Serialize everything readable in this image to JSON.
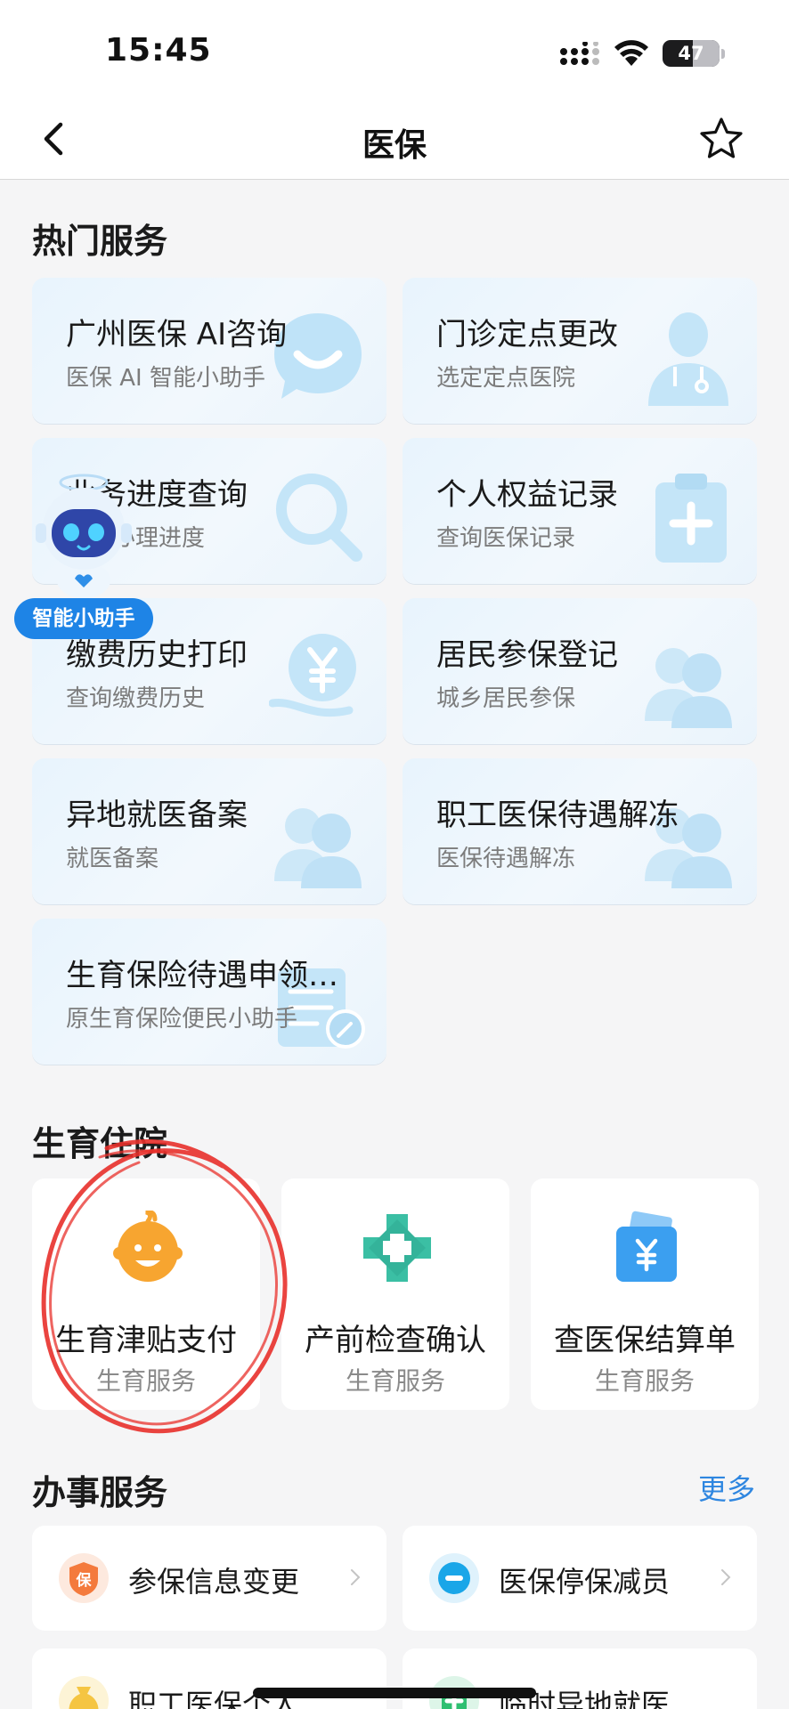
{
  "status_bar": {
    "time": "15:45",
    "battery": "47"
  },
  "nav": {
    "title": "医保",
    "back_icon": "chevron-left-icon",
    "favorite_icon": "star-outline-icon"
  },
  "hot_services": {
    "title": "热门服务",
    "items": [
      {
        "title": "广州医保 AI咨询",
        "subtitle": "医保 AI 智能小助手",
        "icon": "chat-bubble-icon"
      },
      {
        "title": "门诊定点更改",
        "subtitle": "选定定点医院",
        "icon": "doctor-icon"
      },
      {
        "title": "业务进度查询",
        "subtitle": "查询办理进度",
        "icon": "magnifier-icon"
      },
      {
        "title": "个人权益记录",
        "subtitle": "查询医保记录",
        "icon": "medical-clipboard-icon"
      },
      {
        "title": "缴费历史打印",
        "subtitle": "查询缴费历史",
        "icon": "yuan-hand-icon"
      },
      {
        "title": "居民参保登记",
        "subtitle": "城乡居民参保",
        "icon": "people-icon"
      },
      {
        "title": "异地就医备案",
        "subtitle": "就医备案",
        "icon": "people-icon"
      },
      {
        "title": "职工医保待遇解冻",
        "subtitle": "医保待遇解冻",
        "icon": "people-icon"
      },
      {
        "title": "生育保险待遇申领指南",
        "subtitle": "原生育保险便民小助手",
        "icon": "document-edit-icon"
      }
    ]
  },
  "assistant": {
    "label": "智能小助手",
    "icon": "robot-mascot-icon"
  },
  "childbirth": {
    "title": "生育住院",
    "items": [
      {
        "title": "生育津贴支付",
        "subtitle": "生育服务",
        "icon": "baby-face-icon",
        "color": "#f7a530"
      },
      {
        "title": "产前检查确认",
        "subtitle": "生育服务",
        "icon": "medical-cross-icon",
        "color": "#3bbfa4"
      },
      {
        "title": "查医保结算单",
        "subtitle": "生育服务",
        "icon": "yuan-wallet-icon",
        "color": "#3b9ff0"
      }
    ]
  },
  "affairs": {
    "title": "办事服务",
    "more": "更多",
    "items": [
      {
        "label": "参保信息变更",
        "icon": "bao-shield-icon",
        "color": "#f47a3c"
      },
      {
        "label": "医保停保减员",
        "icon": "minus-circle-icon",
        "color": "#1aa6e8"
      },
      {
        "label": "职工医保个人账户",
        "icon": "yuan-bag-icon",
        "color": "#f5c542"
      },
      {
        "label": "临时异地就医备案",
        "icon": "hospital-icon",
        "color": "#2fbf71"
      }
    ]
  },
  "colors": {
    "accent": "#2e86e0",
    "annotation_red": "#e8302b"
  }
}
